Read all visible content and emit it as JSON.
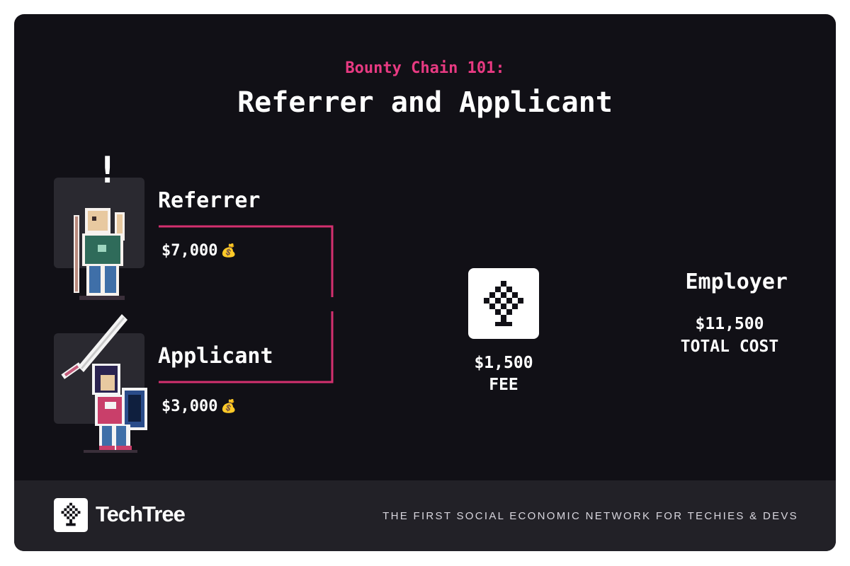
{
  "header": {
    "subtitle": "Bounty Chain 101:",
    "title": "Referrer and Applicant"
  },
  "referrer": {
    "label": "Referrer",
    "amount": "$7,000",
    "amount_icon": "money-bag-icon",
    "alert": "!"
  },
  "applicant": {
    "label": "Applicant",
    "amount": "$3,000",
    "amount_icon": "money-bag-icon"
  },
  "fee": {
    "amount": "$1,500",
    "label": "FEE",
    "icon": "techtree-logo-icon"
  },
  "employer": {
    "label": "Employer",
    "amount": "$11,500",
    "cost_label": "TOTAL COST"
  },
  "footer": {
    "brand": "TechTree",
    "tagline": "THE FIRST SOCIAL ECONOMIC NETWORK FOR TECHIES & DEVS"
  },
  "colors": {
    "background": "#111016",
    "footer": "#222127",
    "accent": "#e83a82",
    "line": "#d4306f"
  }
}
